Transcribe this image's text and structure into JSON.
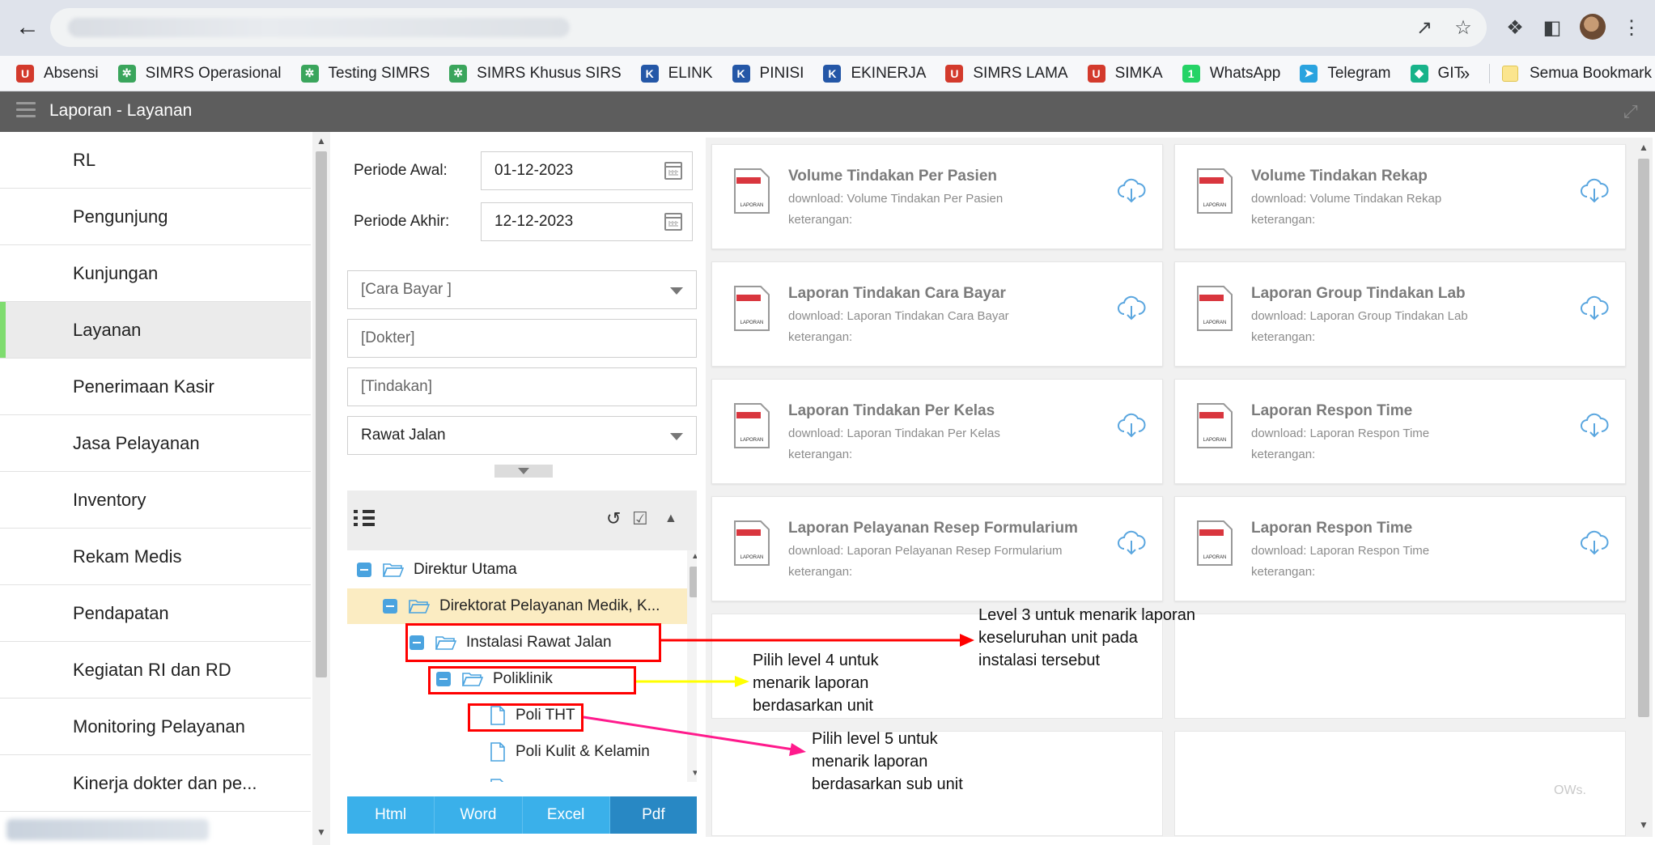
{
  "browser": {
    "bookmarks": [
      {
        "label": "Absensi",
        "icon": "absensi-icon",
        "color": "#d33a2c"
      },
      {
        "label": "SIMRS Operasional",
        "icon": "simrs-icon",
        "color": "#3aa55c"
      },
      {
        "label": "Testing SIMRS",
        "icon": "simrs-icon",
        "color": "#3aa55c"
      },
      {
        "label": "SIMRS Khusus SIRS",
        "icon": "simrs-icon",
        "color": "#3aa55c"
      },
      {
        "label": "ELINK",
        "icon": "elink-icon",
        "color": "#2457a7"
      },
      {
        "label": "PINISI",
        "icon": "pinisi-icon",
        "color": "#2457a7"
      },
      {
        "label": "EKINERJA",
        "icon": "ekinerja-icon",
        "color": "#2457a7"
      },
      {
        "label": "SIMRS LAMA",
        "icon": "simrs-lama-icon",
        "color": "#d33a2c"
      },
      {
        "label": "SIMKA",
        "icon": "simka-icon",
        "color": "#d33a2c"
      },
      {
        "label": "WhatsApp",
        "icon": "whatsapp-icon",
        "color": "#25d366"
      },
      {
        "label": "Telegram",
        "icon": "telegram-icon",
        "color": "#2aa3df"
      },
      {
        "label": "GIT",
        "icon": "git-icon",
        "color": "#18b38a"
      }
    ],
    "more_label": "»",
    "all_bookmarks_label": "Semua Bookmark"
  },
  "app": {
    "title": "Laporan - Layanan"
  },
  "sidebar": {
    "active": "Layanan",
    "items": [
      {
        "label": "RL"
      },
      {
        "label": "Pengunjung"
      },
      {
        "label": "Kunjungan"
      },
      {
        "label": "Layanan"
      },
      {
        "label": "Penerimaan Kasir"
      },
      {
        "label": "Jasa Pelayanan"
      },
      {
        "label": "Inventory"
      },
      {
        "label": "Rekam Medis"
      },
      {
        "label": "Pendapatan"
      },
      {
        "label": "Kegiatan RI dan RD"
      },
      {
        "label": "Monitoring Pelayanan"
      },
      {
        "label": "Kinerja dokter dan pe..."
      }
    ]
  },
  "filters": {
    "periode_awal_label": "Periode Awal:",
    "periode_awal_value": "01-12-2023",
    "periode_akhir_label": "Periode Akhir:",
    "periode_akhir_value": "12-12-2023",
    "cara_bayar": "[Cara Bayar ]",
    "dokter": "[Dokter]",
    "tindakan": "[Tindakan]",
    "jenis": "Rawat Jalan"
  },
  "tree": {
    "nodes": [
      {
        "label": "Direktur Utama",
        "type": "folder"
      },
      {
        "label": "Direktorat Pelayanan Medik, K...",
        "type": "folder"
      },
      {
        "label": "Instalasi Rawat Jalan",
        "type": "folder"
      },
      {
        "label": "Poliklinik",
        "type": "folder"
      },
      {
        "label": "Poli THT",
        "type": "file"
      },
      {
        "label": "Poli Kulit & Kelamin",
        "type": "file"
      }
    ]
  },
  "export_buttons": [
    "Html",
    "Word",
    "Excel",
    "Pdf"
  ],
  "reports": [
    {
      "title": "Volume Tindakan Per Pasien",
      "download": "download: Volume Tindakan Per Pasien",
      "keterangan": "keterangan:"
    },
    {
      "title": "Volume Tindakan Rekap",
      "download": "download: Volume Tindakan Rekap",
      "keterangan": "keterangan:"
    },
    {
      "title": "Laporan Tindakan Cara Bayar",
      "download": "download: Laporan Tindakan Cara Bayar",
      "keterangan": "keterangan:"
    },
    {
      "title": "Laporan Group Tindakan Lab",
      "download": "download: Laporan Group Tindakan Lab",
      "keterangan": "keterangan:"
    },
    {
      "title": "Laporan Tindakan Per Kelas",
      "download": "download: Laporan Tindakan Per Kelas",
      "keterangan": "keterangan:"
    },
    {
      "title": "Laporan Respon Time",
      "download": "download: Laporan Respon Time",
      "keterangan": "keterangan:"
    },
    {
      "title": "Laporan Pelayanan Resep Formularium",
      "download": "download: Laporan Pelayanan Resep Formularium",
      "keterangan": "keterangan:"
    },
    {
      "title": "Laporan Respon Time",
      "download": "download: Laporan Respon Time",
      "keterangan": "keterangan:"
    }
  ],
  "annotations": {
    "level3": [
      "Level 3 untuk menarik laporan",
      "keseluruhan unit pada",
      "instalasi tersebut"
    ],
    "level4": [
      "Pilih level 4 untuk",
      "menarik laporan",
      "berdasarkan unit"
    ],
    "level5": [
      "Pilih level 5 untuk",
      "menarik laporan",
      "berdasarkan sub unit"
    ],
    "colors": {
      "box": "#ff0000",
      "arrow_level3": "#ff0000",
      "arrow_level4": "#ffff00",
      "arrow_level5": "#ff1a8c"
    }
  },
  "faint_text": "OWs."
}
